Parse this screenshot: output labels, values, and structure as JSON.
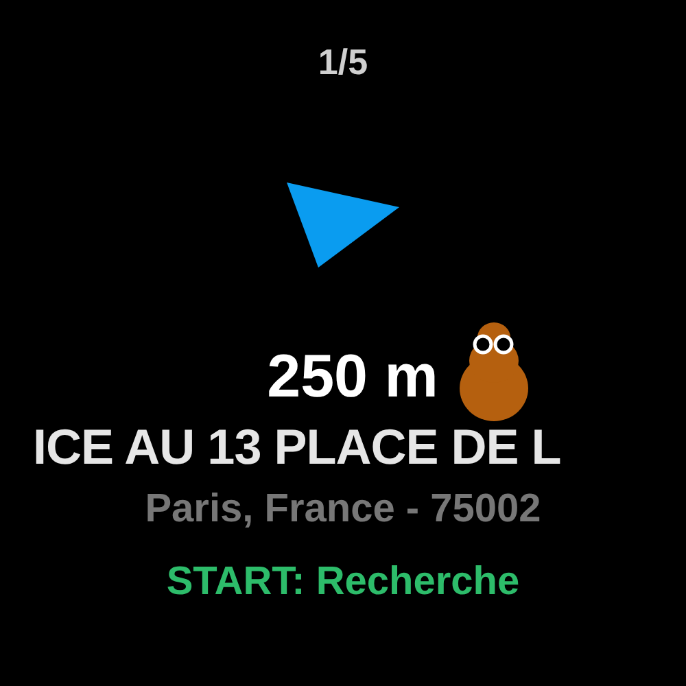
{
  "page_indicator": "1/5",
  "distance": "250 m",
  "title": "ICE AU 13 PLACE DE L",
  "address": "Paris, France - 75002",
  "action": "START: Recherche"
}
